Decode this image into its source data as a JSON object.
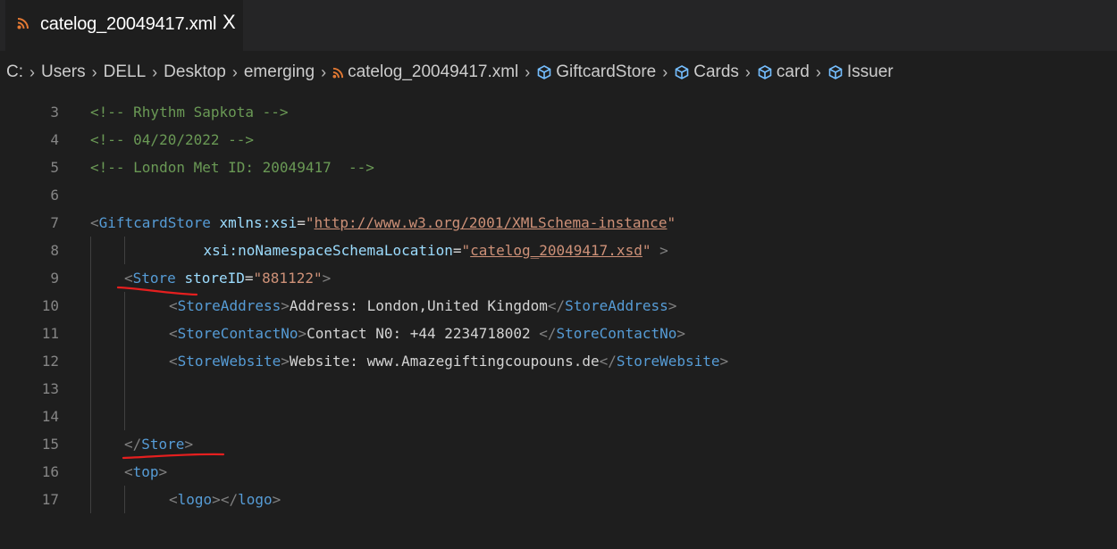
{
  "tab": {
    "title": "catelog_20049417.xml",
    "close_glyph": "X",
    "icon": "rss-feed-icon",
    "icon_color": "#e37933"
  },
  "breadcrumb": {
    "items": [
      {
        "label": "C:",
        "icon": null
      },
      {
        "label": "Users",
        "icon": null
      },
      {
        "label": "DELL",
        "icon": null
      },
      {
        "label": "Desktop",
        "icon": null
      },
      {
        "label": "emerging",
        "icon": null
      },
      {
        "label": "catelog_20049417.xml",
        "icon": "rss-feed-icon"
      },
      {
        "label": "GiftcardStore",
        "icon": "symbol-field-icon"
      },
      {
        "label": "Cards",
        "icon": "symbol-field-icon"
      },
      {
        "label": "card",
        "icon": "symbol-field-icon"
      },
      {
        "label": "Issuer",
        "icon": "symbol-field-icon"
      }
    ],
    "separator": "›",
    "symbol_icon_color": "#75beff"
  },
  "editor": {
    "lines": [
      {
        "n": "3",
        "indent": 0,
        "tokens": [
          {
            "t": "<!-- Rhythm Sapkota -->",
            "c": "comment"
          }
        ]
      },
      {
        "n": "4",
        "indent": 0,
        "tokens": [
          {
            "t": "<!-- 04/20/2022 -->",
            "c": "comment"
          }
        ]
      },
      {
        "n": "5",
        "indent": 0,
        "tokens": [
          {
            "t": "<!-- London Met ID: 20049417  -->",
            "c": "comment"
          }
        ]
      },
      {
        "n": "6",
        "indent": 0,
        "tokens": []
      },
      {
        "n": "7",
        "indent": 0,
        "tokens": [
          {
            "t": "<",
            "c": "bracket"
          },
          {
            "t": "GiftcardStore",
            "c": "tag"
          },
          {
            "t": " ",
            "c": "text"
          },
          {
            "t": "xmlns:xsi",
            "c": "attr"
          },
          {
            "t": "=",
            "c": "text"
          },
          {
            "t": "\"",
            "c": "value"
          },
          {
            "t": "http://www.w3.org/2001/XMLSchema-instance",
            "c": "link"
          },
          {
            "t": "\"",
            "c": "value"
          }
        ]
      },
      {
        "n": "8",
        "indent": 2,
        "tokens": [
          {
            "t": "    xsi:noNamespaceSchemaLocation",
            "c": "attr"
          },
          {
            "t": "=",
            "c": "text"
          },
          {
            "t": "\"",
            "c": "value"
          },
          {
            "t": "catelog_20049417.xsd",
            "c": "link"
          },
          {
            "t": "\"",
            "c": "value"
          },
          {
            "t": " >",
            "c": "bracket"
          }
        ]
      },
      {
        "n": "9",
        "indent": 1,
        "tokens": [
          {
            "t": "<",
            "c": "bracket"
          },
          {
            "t": "Store",
            "c": "tag"
          },
          {
            "t": " ",
            "c": "text"
          },
          {
            "t": "storeID",
            "c": "attr"
          },
          {
            "t": "=",
            "c": "text"
          },
          {
            "t": "\"881122\"",
            "c": "value"
          },
          {
            "t": ">",
            "c": "bracket"
          }
        ]
      },
      {
        "n": "10",
        "indent": 2,
        "tokens": [
          {
            "t": "<",
            "c": "bracket"
          },
          {
            "t": "StoreAddress",
            "c": "tag"
          },
          {
            "t": ">",
            "c": "bracket"
          },
          {
            "t": "Address: London,United Kingdom",
            "c": "text"
          },
          {
            "t": "</",
            "c": "bracket"
          },
          {
            "t": "StoreAddress",
            "c": "tag"
          },
          {
            "t": ">",
            "c": "bracket"
          }
        ]
      },
      {
        "n": "11",
        "indent": 2,
        "tokens": [
          {
            "t": "<",
            "c": "bracket"
          },
          {
            "t": "StoreContactNo",
            "c": "tag"
          },
          {
            "t": ">",
            "c": "bracket"
          },
          {
            "t": "Contact N0: +44 2234718002 ",
            "c": "text"
          },
          {
            "t": "</",
            "c": "bracket"
          },
          {
            "t": "StoreContactNo",
            "c": "tag"
          },
          {
            "t": ">",
            "c": "bracket"
          }
        ]
      },
      {
        "n": "12",
        "indent": 2,
        "tokens": [
          {
            "t": "<",
            "c": "bracket"
          },
          {
            "t": "StoreWebsite",
            "c": "tag"
          },
          {
            "t": ">",
            "c": "bracket"
          },
          {
            "t": "Website: www.Amazegiftingcoupouns.de",
            "c": "text"
          },
          {
            "t": "</",
            "c": "bracket"
          },
          {
            "t": "StoreWebsite",
            "c": "tag"
          },
          {
            "t": ">",
            "c": "bracket"
          }
        ]
      },
      {
        "n": "13",
        "indent": 2,
        "tokens": []
      },
      {
        "n": "14",
        "indent": 2,
        "tokens": []
      },
      {
        "n": "15",
        "indent": 1,
        "tokens": [
          {
            "t": "</",
            "c": "bracket"
          },
          {
            "t": "Store",
            "c": "tag"
          },
          {
            "t": ">",
            "c": "bracket"
          }
        ]
      },
      {
        "n": "16",
        "indent": 1,
        "tokens": [
          {
            "t": "<",
            "c": "bracket"
          },
          {
            "t": "top",
            "c": "tag"
          },
          {
            "t": ">",
            "c": "bracket"
          }
        ]
      },
      {
        "n": "17",
        "indent": 2,
        "tokens": [
          {
            "t": "<",
            "c": "bracket"
          },
          {
            "t": "logo",
            "c": "tag"
          },
          {
            "t": ">",
            "c": "bracket"
          },
          {
            "t": "</",
            "c": "bracket"
          },
          {
            "t": "logo",
            "c": "tag"
          },
          {
            "t": ">",
            "c": "bracket"
          }
        ]
      }
    ]
  },
  "annotations": {
    "color": "#e51f1f",
    "underlined_lines": [
      "9",
      "15"
    ]
  }
}
